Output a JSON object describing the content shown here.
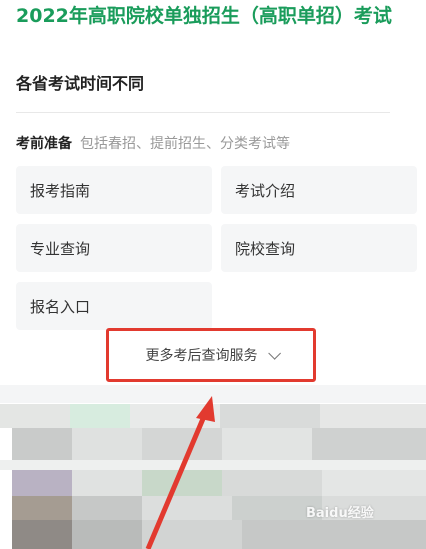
{
  "header": {
    "title": "2022年高职院校单独招生（高职单招）考试",
    "subtitle": "各省考试时间不同"
  },
  "section": {
    "title": "考前准备",
    "hint": "包括春招、提前招生、分类考试等"
  },
  "buttons": {
    "guide": "报考指南",
    "exam_intro": "考试介绍",
    "major_query": "专业查询",
    "school_query": "院校查询",
    "register_entry": "报名入口"
  },
  "more": {
    "label": "更多考后查询服务"
  },
  "watermark": {
    "text": "Baidu经验"
  },
  "colors": {
    "title_green": "#1a9c5b",
    "highlight_red": "#e23a2f"
  }
}
